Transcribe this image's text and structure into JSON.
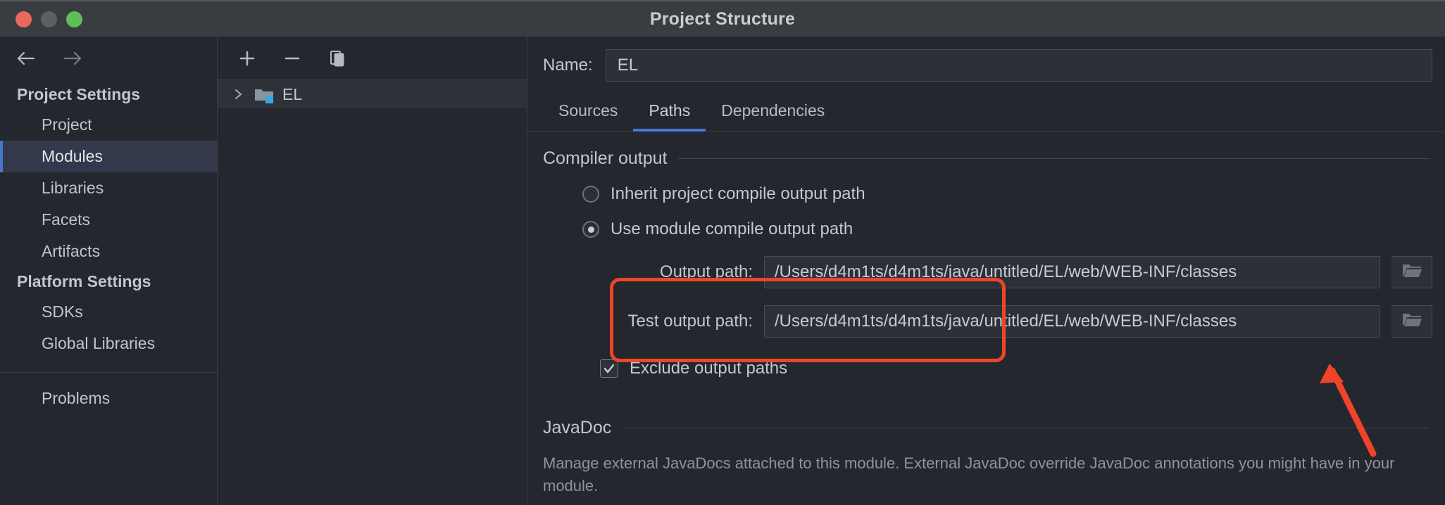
{
  "window": {
    "title": "Project Structure",
    "traffic_lights": [
      "close",
      "minimize",
      "zoom"
    ]
  },
  "sidebar": {
    "nav_back": "back-arrow",
    "nav_forward": "forward-arrow",
    "groups": [
      {
        "title": "Project Settings",
        "items": [
          {
            "label": "Project",
            "selected": false
          },
          {
            "label": "Modules",
            "selected": true
          },
          {
            "label": "Libraries",
            "selected": false
          },
          {
            "label": "Facets",
            "selected": false
          },
          {
            "label": "Artifacts",
            "selected": false
          }
        ]
      },
      {
        "title": "Platform Settings",
        "items": [
          {
            "label": "SDKs",
            "selected": false
          },
          {
            "label": "Global Libraries",
            "selected": false
          }
        ]
      }
    ],
    "footer_items": [
      {
        "label": "Problems",
        "selected": false
      }
    ]
  },
  "tree_panel": {
    "toolbar": {
      "add_label": "+",
      "remove_label": "−",
      "copy_label": "copy-icon"
    },
    "nodes": [
      {
        "label": "EL",
        "expanded": false,
        "icon": "module-folder-icon"
      }
    ]
  },
  "main": {
    "name_label": "Name:",
    "name_value": "EL",
    "tabs": [
      {
        "label": "Sources",
        "active": false
      },
      {
        "label": "Paths",
        "active": true
      },
      {
        "label": "Dependencies",
        "active": false
      }
    ],
    "compiler_output": {
      "section_title": "Compiler output",
      "radios": [
        {
          "label": "Inherit project compile output path",
          "checked": false
        },
        {
          "label": "Use module compile output path",
          "checked": true
        }
      ],
      "output_path": {
        "label": "Output path:",
        "value": "/Users/d4m1ts/d4m1ts/java/untitled/EL/web/WEB-INF/classes",
        "browse_icon": "folder-browse-icon"
      },
      "test_output_path": {
        "label": "Test output path:",
        "value": "/Users/d4m1ts/d4m1ts/java/untitled/EL/web/WEB-INF/classes",
        "browse_icon": "folder-browse-icon"
      },
      "exclude_checkbox": {
        "label": "Exclude output paths",
        "checked": true
      }
    },
    "javadoc": {
      "section_title": "JavaDoc",
      "description": "Manage external JavaDocs attached to this module. External JavaDoc override JavaDoc annotations you might have in your module."
    }
  },
  "annotation": {
    "highlight_color": "#f0442a",
    "shape": "rounded-rectangle-with-arrow"
  },
  "colors": {
    "titlebar_bg": "#393c40",
    "panel_bg": "#24272d",
    "selection_bg": "#33394a",
    "accent_blue": "#4a78d4",
    "annotation_red": "#f0442a"
  }
}
